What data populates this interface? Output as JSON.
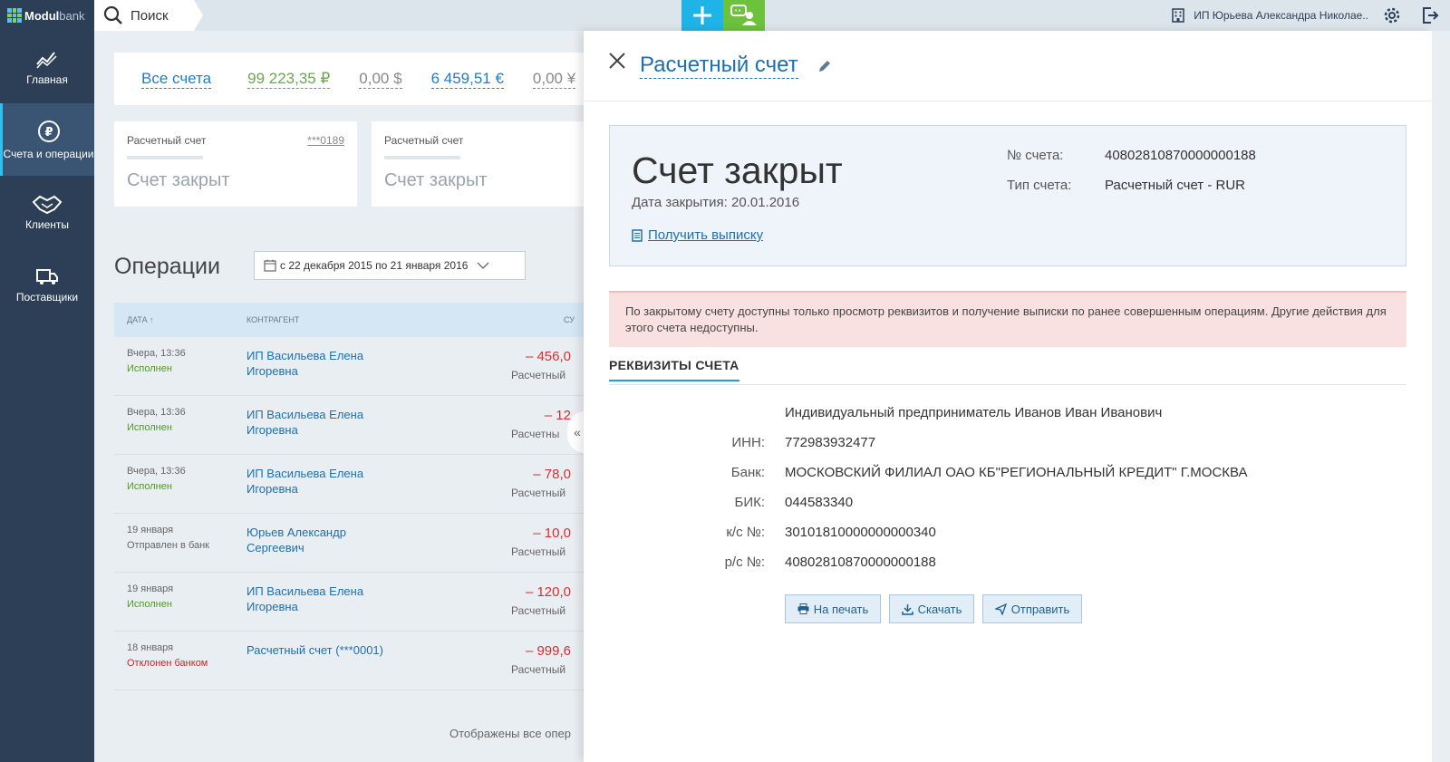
{
  "sidebar": {
    "logo_main": "Modul",
    "logo_light": "bank",
    "items": [
      {
        "label": "Главная"
      },
      {
        "label": "Счета и операции"
      },
      {
        "label": "Клиенты"
      },
      {
        "label": "Поставщики"
      }
    ]
  },
  "topbar": {
    "search_label": "Поиск",
    "plus_label": "+",
    "company_name": "ИП Юрьева Александра Николае.."
  },
  "totals": {
    "all_label": "Все счета",
    "rub": "99 223,35 ₽",
    "usd": "0,00 $",
    "eur": "6 459,51 €",
    "other": "0,00 ¥"
  },
  "account_cards": [
    {
      "title": "Расчетный счет",
      "number": "***0189",
      "status": "Счет закрыт"
    },
    {
      "title": "Расчетный счет",
      "number": "***",
      "status": "Счет закрыт"
    }
  ],
  "operations": {
    "title": "Операции",
    "date_range": "с 22 декабря 2015 по 21 января 2016",
    "columns": [
      "ДАТА ↑",
      "КОНТРАГЕНТ",
      "СУ"
    ],
    "rows": [
      {
        "date": "Вчера, 13:36",
        "status": "Исполнен",
        "status_type": "ok",
        "party": "ИП Васильева Елена Игоревна",
        "amount": "– 456,0",
        "account": "Расчетный"
      },
      {
        "date": "Вчера, 13:36",
        "status": "Исполнен",
        "status_type": "ok",
        "party": "ИП Васильева Елена Игоревна",
        "amount": "– 12",
        "account": "Расчетны"
      },
      {
        "date": "Вчера, 13:36",
        "status": "Исполнен",
        "status_type": "ok",
        "party": "ИП Васильева Елена Игоревна",
        "amount": "– 78,0",
        "account": "Расчетный"
      },
      {
        "date": "19 января",
        "status": "Отправлен в банк",
        "status_type": "sent",
        "party": "Юрьев Александр Сергеевич",
        "amount": "– 10,0",
        "account": "Расчетный"
      },
      {
        "date": "19 января",
        "status": "Исполнен",
        "status_type": "ok",
        "party": "ИП Васильева Елена Игоревна",
        "amount": "– 120,0",
        "account": "Расчетный"
      },
      {
        "date": "18 января",
        "status": "Отклонен банком",
        "status_type": "err",
        "party": "Расчетный счет (***0001)",
        "amount": "– 999,6",
        "account": "Расчетный"
      }
    ],
    "footer": "Отображены все опер"
  },
  "panel": {
    "title": "Расчетный счет",
    "collapse_label": "«",
    "status_big": "Счет закрыт",
    "close_date": "Дата закрытия: 20.01.2016",
    "statement_link": "Получить выписку",
    "account_number_label": "№ счета:",
    "account_number": "40802810870000000188",
    "account_type_label": "Тип счета:",
    "account_type": "Расчетный счет - RUR",
    "warning": "По закрытому счету доступны только просмотр реквизитов и получение выписки по ранее совершенным операциям. Другие действия для этого счета недоступны.",
    "req_tab": "РЕКВИЗИТЫ СЧЕТА",
    "holder": "Индивидуальный предприниматель Иванов Иван Иванович",
    "requisites": [
      {
        "label": "ИНН:",
        "value": "772983932477"
      },
      {
        "label": "Банк:",
        "value": "МОСКОВСКИЙ ФИЛИАЛ ОАО КБ\"РЕГИОНАЛЬНЫЙ КРЕДИТ\" Г.МОСКВА"
      },
      {
        "label": "БИК:",
        "value": "044583340"
      },
      {
        "label": "к/с №:",
        "value": "30101810000000000340"
      },
      {
        "label": "р/с №:",
        "value": "40802810870000000188"
      }
    ],
    "buttons": {
      "print": "На печать",
      "download": "Скачать",
      "send": "Отправить"
    }
  },
  "colors": {
    "sidebar": "#2c3f57",
    "accent_blue": "#1fb4e8",
    "accent_green": "#6cc23a",
    "link": "#1e6fb0",
    "negative": "#d32f2f"
  }
}
